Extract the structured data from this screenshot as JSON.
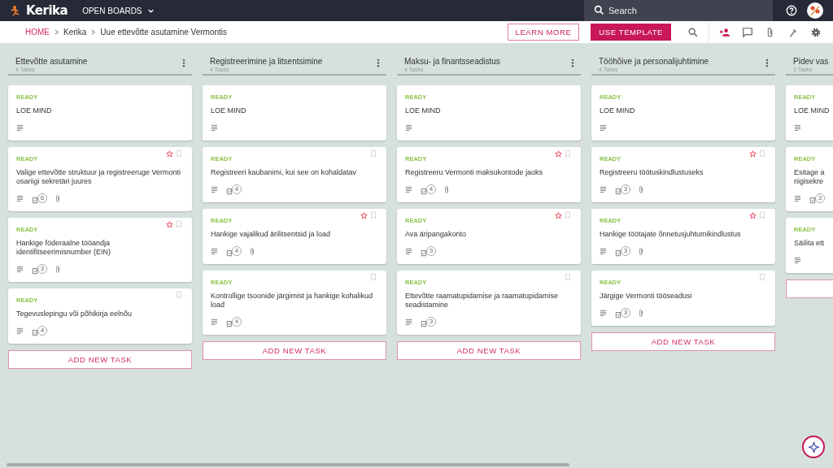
{
  "topbar": {
    "brand": "Kerika",
    "boards_menu": "OPEN BOARDS",
    "search": {
      "placeholder": "Search"
    }
  },
  "breadcrumb": [
    "HOME",
    "Kerika",
    "Uue ettevõtte asutamine Vermontis"
  ],
  "actions": {
    "learn_more": "LEARN MORE",
    "use_template": "USE TEMPLATE"
  },
  "columns": [
    {
      "title": "Ettevõtte asutamine",
      "count": "4 Tasks",
      "add_label": "ADD NEW TASK",
      "cards": [
        {
          "status": "READY",
          "title": "LOE MIND",
          "attachment": false,
          "starred": false,
          "bookmark": false
        },
        {
          "status": "READY",
          "title": "Valige ettevõtte struktuur ja registreeruge Vermonti osariigi sekretäri juures",
          "checklist": "6",
          "attachment": true,
          "starred": true,
          "bookmark": true
        },
        {
          "status": "READY",
          "title": "Hankige föderaalne tööandja identifitseerimisnumber (EIN)",
          "checklist": "3",
          "attachment": true,
          "starred": true,
          "bookmark": true
        },
        {
          "status": "READY",
          "title": "Tegevuslepingu või põhikirja eelnõu",
          "checklist": "4",
          "attachment": false,
          "starred": false,
          "bookmark": true
        }
      ]
    },
    {
      "title": "Registreerimine ja litsentsimine",
      "count": "4 Tasks",
      "add_label": "ADD NEW TASK",
      "cards": [
        {
          "status": "READY",
          "title": "LOE MIND",
          "attachment": false,
          "starred": false,
          "bookmark": false
        },
        {
          "status": "READY",
          "title": "Registreeri kaubanimi, kui see on kohaldatav",
          "checklist": "4",
          "attachment": false,
          "starred": false,
          "bookmark": true
        },
        {
          "status": "READY",
          "title": "Hankige vajalikud ärilitsentsid ja load",
          "checklist": "4",
          "attachment": true,
          "starred": true,
          "bookmark": true
        },
        {
          "status": "READY",
          "title": "Kontrollige tsoonide järgimist ja hankige kohalikud load",
          "checklist": "4",
          "attachment": false,
          "starred": false,
          "bookmark": true
        }
      ]
    },
    {
      "title": "Maksu- ja finantsseadistus",
      "count": "4 Tasks",
      "add_label": "ADD NEW TASK",
      "cards": [
        {
          "status": "READY",
          "title": "LOE MIND",
          "attachment": false,
          "starred": false,
          "bookmark": false
        },
        {
          "status": "READY",
          "title": "Registreeru Vermonti maksukontode jaoks",
          "checklist": "4",
          "attachment": true,
          "starred": true,
          "bookmark": true
        },
        {
          "status": "READY",
          "title": "Ava äripangakonto",
          "checklist": "3",
          "attachment": false,
          "starred": true,
          "bookmark": true
        },
        {
          "status": "READY",
          "title": "Ettevõtte raamatupidamise ja raamatupidamise seadistamine",
          "checklist": "3",
          "attachment": false,
          "starred": false,
          "bookmark": true
        }
      ]
    },
    {
      "title": "Tööhõive ja personalijuhtimine",
      "count": "4 Tasks",
      "add_label": "ADD NEW TASK",
      "cards": [
        {
          "status": "READY",
          "title": "LOE MIND",
          "attachment": false,
          "starred": false,
          "bookmark": false
        },
        {
          "status": "READY",
          "title": "Registreeru töötuskindlustuseks",
          "checklist": "3",
          "attachment": true,
          "starred": true,
          "bookmark": true
        },
        {
          "status": "READY",
          "title": "Hankige töötajate õnnetusjuhtumikindlustus",
          "checklist": "3",
          "attachment": true,
          "starred": true,
          "bookmark": true
        },
        {
          "status": "READY",
          "title": "Järgige Vermonti tööseadusi",
          "checklist": "3",
          "attachment": true,
          "starred": false,
          "bookmark": true
        }
      ]
    },
    {
      "title": "Pidev vas",
      "count": "3 Tasks",
      "cards": [
        {
          "status": "READY",
          "title": "LOE MIND",
          "attachment": false,
          "starred": false,
          "bookmark": false
        },
        {
          "status": "READY",
          "title": "Esitage a\nriigisekre",
          "checklist": "3",
          "attachment": false,
          "starred": false,
          "bookmark": false
        },
        {
          "status": "READY",
          "title": "Säilita ett",
          "attachment": false,
          "starred": false,
          "bookmark": false
        }
      ]
    }
  ]
}
